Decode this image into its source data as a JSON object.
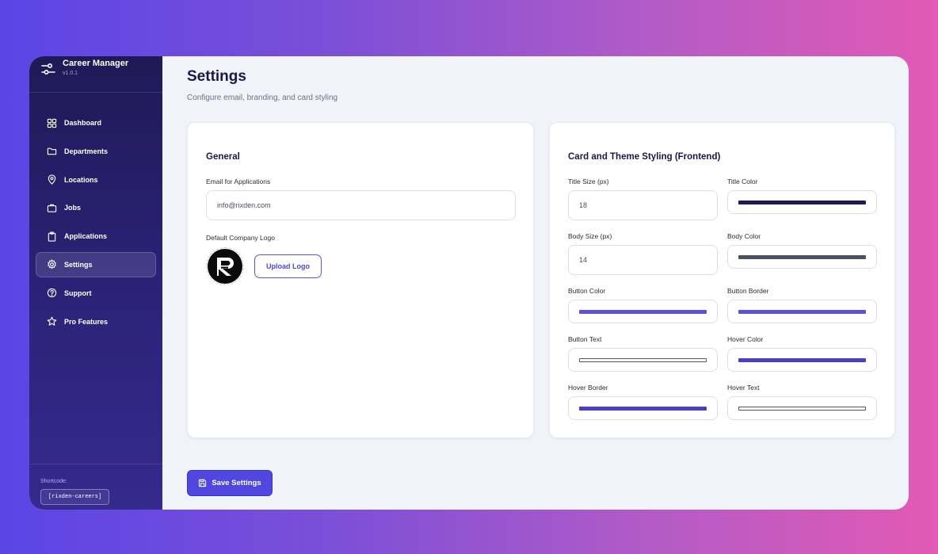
{
  "sidebar": {
    "brand_title": "Career Manager",
    "brand_version": "v1.0.1",
    "items": [
      {
        "label": "Dashboard",
        "icon": "grid-icon"
      },
      {
        "label": "Departments",
        "icon": "folder-icon"
      },
      {
        "label": "Locations",
        "icon": "map-pin-icon"
      },
      {
        "label": "Jobs",
        "icon": "briefcase-icon"
      },
      {
        "label": "Applications",
        "icon": "clipboard-icon"
      },
      {
        "label": "Settings",
        "icon": "gear-icon",
        "active": true
      },
      {
        "label": "Support",
        "icon": "help-circle-icon"
      },
      {
        "label": "Pro Features",
        "icon": "star-icon"
      }
    ],
    "shortcode_label": "Shortcode:",
    "shortcode_value": "[rixden-careers]"
  },
  "page": {
    "title": "Settings",
    "subtitle": "Configure email, branding, and card styling"
  },
  "general": {
    "title": "General",
    "email_label": "Email for Applications",
    "email_value": "info@rixden.com",
    "logo_label": "Default Company Logo",
    "upload_label": "Upload Logo"
  },
  "theme": {
    "title": "Card and Theme Styling (Frontend)",
    "title_size_label": "Title Size (px)",
    "title_size_value": "18",
    "title_color_label": "Title Color",
    "title_color": "#1f1a56",
    "body_size_label": "Body Size (px)",
    "body_size_value": "14",
    "body_color_label": "Body Color",
    "body_color": "#4b5160",
    "button_color_label": "Button Color",
    "button_color": "#5b55d6",
    "button_border_label": "Button Border",
    "button_border": "#5b55d6",
    "button_text_label": "Button Text",
    "button_text": "#ffffff",
    "hover_color_label": "Hover Color",
    "hover_color": "#4841c4",
    "hover_border_label": "Hover Border",
    "hover_border": "#4841c4",
    "hover_text_label": "Hover Text",
    "hover_text": "#ffffff"
  },
  "actions": {
    "save_label": "Save Settings"
  }
}
